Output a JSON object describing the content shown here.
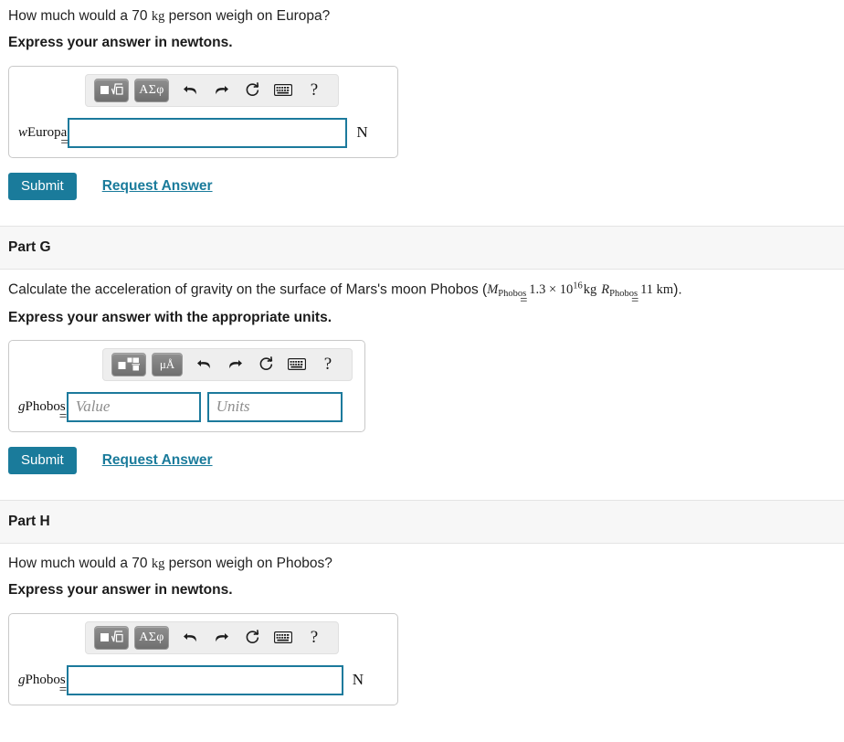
{
  "parts": [
    {
      "id": "part-f-tail",
      "header": null,
      "question": {
        "prefix": "How much would a 70 ",
        "math_unit": "kg",
        "suffix": " person weigh on Europa?"
      },
      "instruction": "Express your answer in newtons.",
      "toolbar": {
        "template_button": "template-icon",
        "symbol_button": "ΑΣφ",
        "undo": "undo-icon",
        "redo": "redo-icon",
        "reset": "reset-icon",
        "keyboard": "keyboard-icon",
        "help": "?"
      },
      "input": {
        "variable": "w",
        "subscript": "Europa",
        "equals": "=",
        "value": "",
        "placeholder": "",
        "unit_suffix": "N"
      },
      "actions": {
        "submit": "Submit",
        "request": "Request Answer"
      }
    },
    {
      "id": "part-g",
      "header": "Part G",
      "question": {
        "prefix": "Calculate the acceleration of gravity on the surface of Mars's moon Phobos (",
        "m_var": "M",
        "m_sub": "Phobos",
        "m_eq": "=",
        "m_value": "1.3 × 10",
        "m_exp": "16",
        "m_unit": "kg",
        "r_var": "R",
        "r_sub": "Phobos",
        "r_eq": "=",
        "r_value": "11 km",
        "suffix": ")."
      },
      "instruction": "Express your answer with the appropriate units.",
      "toolbar": {
        "template_button": "template-units-icon",
        "symbol_button": "μÅ",
        "undo": "undo-icon",
        "redo": "redo-icon",
        "reset": "reset-icon",
        "keyboard": "keyboard-icon",
        "help": "?"
      },
      "input": {
        "variable": "g",
        "subscript": "Phobos",
        "equals": "=",
        "value": "",
        "value_placeholder": "Value",
        "units_placeholder": "Units"
      },
      "actions": {
        "submit": "Submit",
        "request": "Request Answer"
      }
    },
    {
      "id": "part-h",
      "header": "Part H",
      "question": {
        "prefix": "How much would a 70 ",
        "math_unit": "kg",
        "suffix": " person weigh on Phobos?"
      },
      "instruction": "Express your answer in newtons.",
      "toolbar": {
        "template_button": "template-icon",
        "symbol_button": "ΑΣφ",
        "undo": "undo-icon",
        "redo": "redo-icon",
        "reset": "reset-icon",
        "keyboard": "keyboard-icon",
        "help": "?"
      },
      "input": {
        "variable": "g",
        "subscript": "Phobos",
        "equals": "=",
        "value": "",
        "placeholder": "",
        "unit_suffix": "N"
      }
    }
  ],
  "colors": {
    "accent_teal": "#1a7b9b",
    "input_border": "#1c7a9c",
    "band_bg": "#f7f7f7",
    "box_border": "#c9c9c9",
    "toolbar_bg": "#eeeeee",
    "button_gray": "#7d7d7d"
  }
}
